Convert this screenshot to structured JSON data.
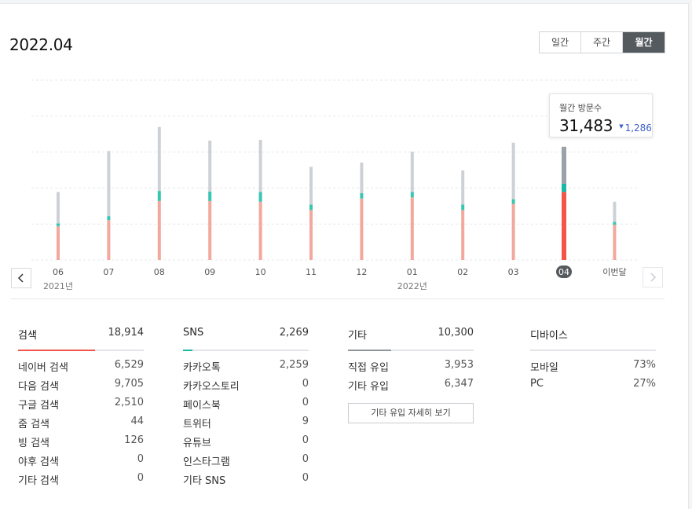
{
  "page": {
    "title": "2022.04"
  },
  "period_tabs": [
    "일간",
    "주간",
    "월간"
  ],
  "active_tab_index": 2,
  "tooltip": {
    "label": "월간 방문수",
    "value": "31,483",
    "delta": "1,286",
    "delta_direction": "down"
  },
  "colors": {
    "search": "#f2a89c",
    "sns": "#37c6b2",
    "other": "#cdd1d6",
    "selected_search": "#f4554a",
    "selected_sns": "#17b9a4",
    "selected_other": "#9aa1a9",
    "accent_blue": "#3c5fc9"
  },
  "chart_data": {
    "type": "bar",
    "stacked": true,
    "categories": [
      "06",
      "07",
      "08",
      "09",
      "10",
      "11",
      "12",
      "01",
      "02",
      "03",
      "04",
      "이번달"
    ],
    "year_labels": [
      {
        "text": "2021년",
        "category_index": 0
      },
      {
        "text": "2022년",
        "category_index": 7
      }
    ],
    "selected_index": 10,
    "series": [
      {
        "key": "search",
        "values": [
          9400,
          11100,
          16400,
          16400,
          16200,
          13900,
          17100,
          17400,
          13900,
          15600,
          18914,
          9800
        ]
      },
      {
        "key": "sns",
        "values": [
          800,
          1100,
          2800,
          2600,
          2700,
          1500,
          1500,
          1500,
          1500,
          1300,
          2269,
          800
        ]
      },
      {
        "key": "other",
        "values": [
          8700,
          18100,
          17800,
          14200,
          14500,
          10500,
          8500,
          11200,
          9500,
          15700,
          10300,
          5600
        ]
      }
    ],
    "ylim": [
      0,
      50000
    ],
    "grid": true
  },
  "stats": {
    "search": {
      "title": "검색",
      "total": "18,914",
      "rows": [
        {
          "label": "네이버 검색",
          "value": "6,529"
        },
        {
          "label": "다음 검색",
          "value": "9,705"
        },
        {
          "label": "구글 검색",
          "value": "2,510"
        },
        {
          "label": "줌 검색",
          "value": "44"
        },
        {
          "label": "빙 검색",
          "value": "126"
        },
        {
          "label": "야후 검색",
          "value": "0"
        },
        {
          "label": "기타 검색",
          "value": "0"
        }
      ]
    },
    "sns": {
      "title": "SNS",
      "total": "2,269",
      "rows": [
        {
          "label": "카카오톡",
          "value": "2,259"
        },
        {
          "label": "카카오스토리",
          "value": "0"
        },
        {
          "label": "페이스북",
          "value": "0"
        },
        {
          "label": "트위터",
          "value": "9"
        },
        {
          "label": "유튜브",
          "value": "0"
        },
        {
          "label": "인스타그램",
          "value": "0"
        },
        {
          "label": "기타 SNS",
          "value": "0"
        }
      ]
    },
    "other": {
      "title": "기타",
      "total": "10,300",
      "rows": [
        {
          "label": "직접 유입",
          "value": "3,953"
        },
        {
          "label": "기타 유입",
          "value": "6,347"
        }
      ],
      "detail_button": "기타 유입 자세히 보기"
    },
    "device": {
      "title": "디바이스",
      "rows": [
        {
          "label": "모바일",
          "value": "73%"
        },
        {
          "label": "PC",
          "value": "27%"
        }
      ]
    }
  }
}
